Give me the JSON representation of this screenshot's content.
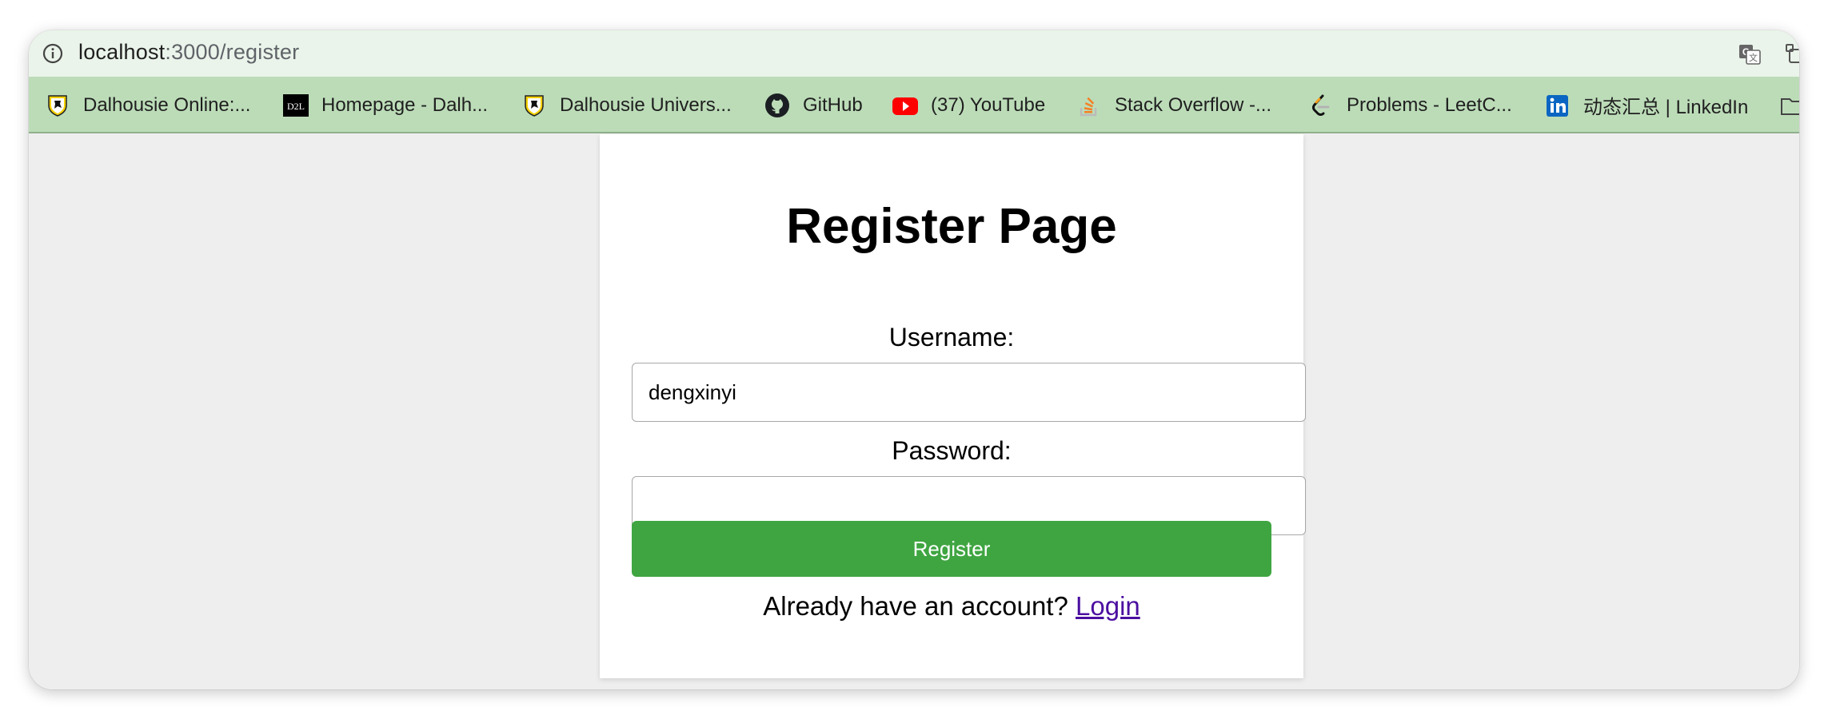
{
  "browser": {
    "url_host": "localhost",
    "url_path": ":3000/register",
    "icons": [
      "info-icon",
      "translate-icon",
      "extension-icon"
    ]
  },
  "bookmarks": [
    {
      "label": "Dalhousie Online:...",
      "icon": "dal-shield-icon"
    },
    {
      "label": "Homepage - Dalh...",
      "icon": "d2l-icon"
    },
    {
      "label": "Dalhousie Univers...",
      "icon": "dal-shield-icon"
    },
    {
      "label": "GitHub",
      "icon": "github-icon"
    },
    {
      "label": "(37) YouTube",
      "icon": "youtube-icon"
    },
    {
      "label": "Stack Overflow -...",
      "icon": "stackoverflow-icon"
    },
    {
      "label": "Problems - LeetC...",
      "icon": "leetcode-icon"
    },
    {
      "label": "动态汇总 | LinkedIn",
      "icon": "linkedin-icon"
    }
  ],
  "form": {
    "title": "Register Page",
    "username_label": "Username:",
    "username_value": "dengxinyi",
    "password_label": "Password:",
    "password_value": "",
    "submit_label": "Register",
    "footer_text": "Already have an account?",
    "login_link": "Login"
  },
  "colors": {
    "urlbar_bg": "#eaf4ea",
    "bookmarks_bg": "#bcdcb8",
    "button_bg": "#3fa541",
    "link": "#4b0fa0"
  }
}
